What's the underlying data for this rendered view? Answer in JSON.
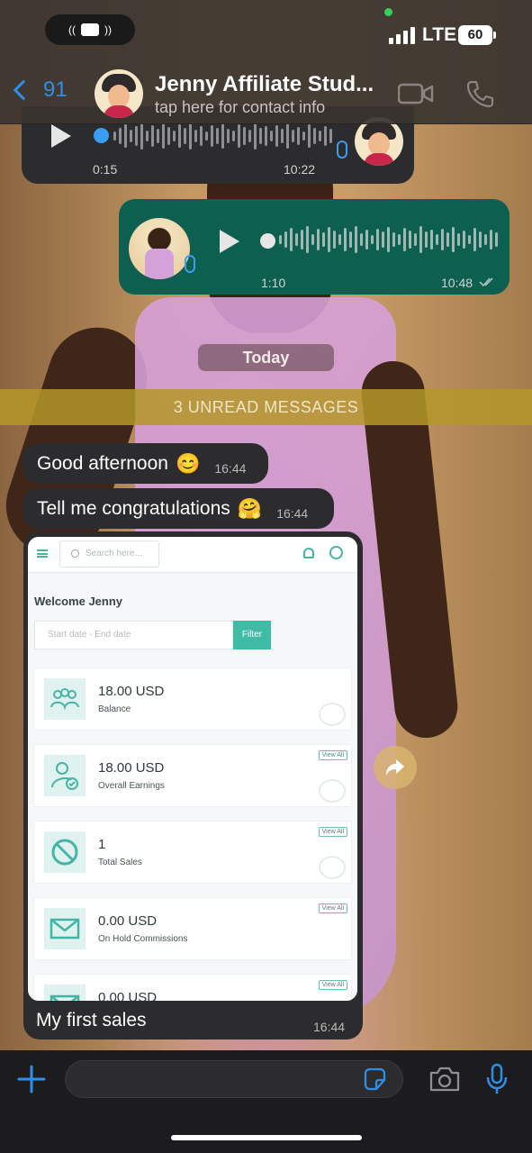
{
  "status_bar": {
    "network": "LTE",
    "battery": "60"
  },
  "header": {
    "back_count": "91",
    "contact_name": "Jenny Affiliate Stud...",
    "contact_subtitle": "tap here for contact info"
  },
  "voice_in": {
    "duration": "0:15",
    "time": "10:22"
  },
  "voice_out": {
    "duration": "1:10",
    "time": "10:48"
  },
  "date_chip": "Today",
  "unread_banner": "3 UNREAD MESSAGES",
  "messages": [
    {
      "text": "Good afternoon",
      "emoji": "😊",
      "time": "16:44"
    },
    {
      "text": "Tell me congratulations",
      "emoji": "🤗",
      "time": "16:44"
    }
  ],
  "image_message": {
    "caption": "My first sales",
    "time": "16:44",
    "screenshot": {
      "search_placeholder": "Search here...",
      "welcome": "Welcome Jenny",
      "date_placeholder": "Start date - End date",
      "filter_label": "Filter",
      "view_all": "View All",
      "cards": [
        {
          "value": "18.00 USD",
          "label": "Balance",
          "icon": "users-group-icon"
        },
        {
          "value": "18.00 USD",
          "label": "Overall Earnings",
          "icon": "user-check-icon"
        },
        {
          "value": "1",
          "label": "Total Sales",
          "icon": "block-icon"
        },
        {
          "value": "0.00 USD",
          "label": "On Hold Commissions",
          "icon": "envelope-icon"
        },
        {
          "value": "0.00 USD",
          "label": "",
          "icon": "envelope-icon"
        }
      ]
    }
  },
  "input": {
    "placeholder": ""
  },
  "colors": {
    "accent": "#2f8fe6",
    "outgoing_bubble": "#0d5f4f",
    "incoming_bubble": "#2c2c2e",
    "dashboard_teal": "#40bca6"
  }
}
